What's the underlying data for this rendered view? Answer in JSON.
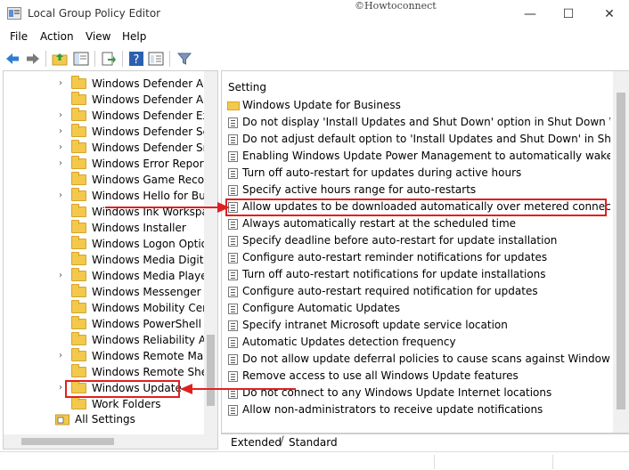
{
  "window": {
    "title": "Local Group Policy Editor",
    "watermark": "©Howtoconnect",
    "minimize": "—",
    "maximize": "☐",
    "close": "✕"
  },
  "menu": [
    "File",
    "Action",
    "View",
    "Help"
  ],
  "tree": {
    "items": [
      {
        "label": "Windows Defender Ant",
        "expandable": true
      },
      {
        "label": "Windows Defender App",
        "expandable": false
      },
      {
        "label": "Windows Defender Exp",
        "expandable": true
      },
      {
        "label": "Windows Defender Sec",
        "expandable": true
      },
      {
        "label": "Windows Defender Sma",
        "expandable": true
      },
      {
        "label": "Windows Error Reportin",
        "expandable": true
      },
      {
        "label": "Windows Game Record",
        "expandable": false
      },
      {
        "label": "Windows Hello for Busi",
        "expandable": true
      },
      {
        "label": "Windows Ink Workspac",
        "expandable": false
      },
      {
        "label": "Windows Installer",
        "expandable": false
      },
      {
        "label": "Windows Logon Option",
        "expandable": false
      },
      {
        "label": "Windows Media Digital",
        "expandable": false
      },
      {
        "label": "Windows Media Player",
        "expandable": true
      },
      {
        "label": "Windows Messenger",
        "expandable": false
      },
      {
        "label": "Windows Mobility Cent",
        "expandable": false
      },
      {
        "label": "Windows PowerShell",
        "expandable": false
      },
      {
        "label": "Windows Reliability An",
        "expandable": false
      },
      {
        "label": "Windows Remote Mana",
        "expandable": true
      },
      {
        "label": "Windows Remote Shell",
        "expandable": false
      },
      {
        "label": "Windows Update",
        "expandable": true,
        "selected": true
      },
      {
        "label": "Work Folders",
        "expandable": false
      }
    ],
    "all_settings": "All Settings"
  },
  "settings": {
    "header": "Setting",
    "folder_row": "Windows Update for Business",
    "rows": [
      "Do not display 'Install Updates and Shut Down' option in Shut Down Wind...",
      "Do not adjust default option to 'Install Updates and Shut Down' in Shut Do...",
      "Enabling Windows Update Power Management to automatically wake up t...",
      "Turn off auto-restart for updates during active hours",
      "Specify active hours range for auto-restarts",
      "Allow updates to be downloaded automatically over metered connections",
      "Always automatically restart at the scheduled time",
      "Specify deadline before auto-restart for update installation",
      "Configure auto-restart reminder notifications for updates",
      "Turn off auto-restart notifications for update installations",
      "Configure auto-restart required notification for updates",
      "Configure Automatic Updates",
      "Specify intranet Microsoft update service location",
      "Automatic Updates detection frequency",
      "Do not allow update deferral policies to cause scans against Windows Upd...",
      "Remove access to use all Windows Update features",
      "Do not connect to any Windows Update Internet locations",
      "Allow non-administrators to receive update notifications"
    ],
    "col2_glyph": "N"
  },
  "tabs": [
    "Extended",
    "Standard"
  ]
}
